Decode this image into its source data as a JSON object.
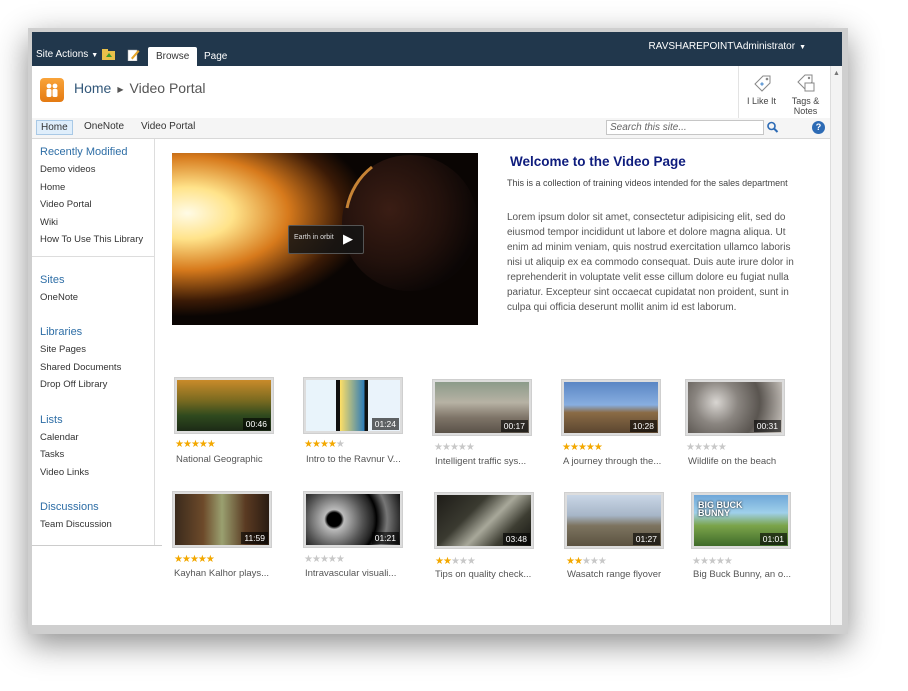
{
  "ribbon": {
    "site_actions": "Site Actions",
    "tabs": [
      "Browse",
      "Page"
    ],
    "user": "RAVSHAREPOINT\\Administrator"
  },
  "title": {
    "home": "Home",
    "current": "Video Portal",
    "i_like_it": "I Like It",
    "tags_notes_1": "Tags &",
    "tags_notes_2": "Notes"
  },
  "topnav": {
    "items": [
      "Home",
      "OneNote",
      "Video Portal"
    ],
    "search_placeholder": "Search this site..."
  },
  "leftnav": {
    "recently_modified": {
      "header": "Recently Modified",
      "items": [
        "Demo videos",
        "Home",
        "Video Portal",
        "Wiki",
        "How To Use This Library"
      ]
    },
    "sites": {
      "header": "Sites",
      "items": [
        "OneNote"
      ]
    },
    "libraries": {
      "header": "Libraries",
      "items": [
        "Site Pages",
        "Shared Documents",
        "Drop Off Library"
      ]
    },
    "lists": {
      "header": "Lists",
      "items": [
        "Calendar",
        "Tasks",
        "Video Links"
      ]
    },
    "discussions": {
      "header": "Discussions",
      "items": [
        "Team Discussion"
      ]
    }
  },
  "hero": {
    "play_label": "Earth in orbit"
  },
  "welcome": {
    "title": "Welcome to the Video Page",
    "subtitle": "This is a collection of training videos intended for the sales department",
    "body": "Lorem ipsum dolor sit amet, consectetur adipisicing elit, sed do eiusmod tempor incididunt ut labore et dolore magna aliqua. Ut enim ad minim veniam, quis nostrud exercitation ullamco laboris nisi ut aliquip ex ea commodo consequat. Duis aute irure dolor in reprehenderit in voluptate velit esse cillum dolore eu fugiat nulla pariatur. Excepteur sint occaecat cupidatat non proident, sunt in culpa qui officia deserunt mollit anim id est laborum."
  },
  "videos": [
    {
      "title": "National Geographic",
      "duration": "00:46",
      "rating": 5
    },
    {
      "title": "Intro to the Ravnur V...",
      "duration": "01:24",
      "rating": 4
    },
    {
      "title": "Intelligent traffic sys...",
      "duration": "00:17",
      "rating": 0
    },
    {
      "title": "A journey through the...",
      "duration": "10:28",
      "rating": 5
    },
    {
      "title": "Wildlife on the beach",
      "duration": "00:31",
      "rating": 0
    },
    {
      "title": "Kayhan Kalhor plays...",
      "duration": "11:59",
      "rating": 5
    },
    {
      "title": "Intravascular visuali...",
      "duration": "01:21",
      "rating": 0
    },
    {
      "title": "Tips on quality check...",
      "duration": "03:48",
      "rating": 2
    },
    {
      "title": "Wasatch range flyover",
      "duration": "01:27",
      "rating": 2
    },
    {
      "title": "Big Buck Bunny, an o...",
      "duration": "01:01",
      "rating": 0
    }
  ],
  "colors": {
    "ribbon_bg": "#21374c",
    "link_blue": "#2e6ea6",
    "star_on": "#f3a800",
    "star_off": "#c8c8c8",
    "welcome_title": "#0e1c7d"
  }
}
